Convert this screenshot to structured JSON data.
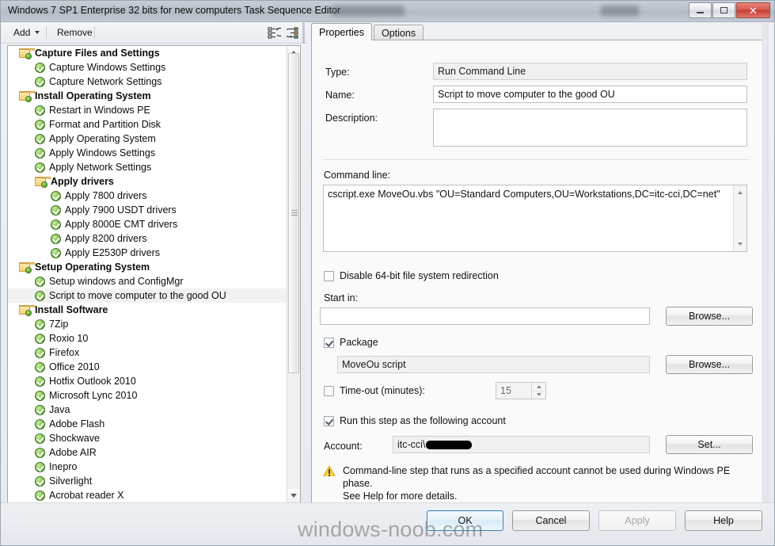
{
  "window": {
    "title": "Windows 7 SP1 Enterprise 32 bits for new computers Task Sequence Editor",
    "minimize_label": "Minimize",
    "maximize_label": "Maximize",
    "close_label": "Close"
  },
  "toolbar": {
    "add_label": "Add",
    "remove_label": "Remove",
    "icon_collapse": "collapse-all-icon",
    "icon_expand": "expand-all-icon"
  },
  "tree": {
    "items": [
      {
        "label": "Capture Files and Settings",
        "level": 1,
        "icon": "folder",
        "group": true,
        "selected": false
      },
      {
        "label": "Capture Windows Settings",
        "level": 2,
        "icon": "check",
        "group": false,
        "selected": false
      },
      {
        "label": "Capture Network Settings",
        "level": 2,
        "icon": "check",
        "group": false,
        "selected": false
      },
      {
        "label": "Install Operating System",
        "level": 1,
        "icon": "folder",
        "group": true,
        "selected": false
      },
      {
        "label": "Restart in Windows PE",
        "level": 2,
        "icon": "check",
        "group": false,
        "selected": false
      },
      {
        "label": "Format and Partition Disk",
        "level": 2,
        "icon": "check",
        "group": false,
        "selected": false
      },
      {
        "label": "Apply Operating System",
        "level": 2,
        "icon": "check",
        "group": false,
        "selected": false
      },
      {
        "label": "Apply Windows Settings",
        "level": 2,
        "icon": "check",
        "group": false,
        "selected": false
      },
      {
        "label": "Apply Network Settings",
        "level": 2,
        "icon": "check",
        "group": false,
        "selected": false
      },
      {
        "label": "Apply drivers",
        "level": 2,
        "icon": "folder",
        "group": true,
        "selected": false
      },
      {
        "label": "Apply 7800 drivers",
        "level": 3,
        "icon": "check",
        "group": false,
        "selected": false
      },
      {
        "label": "Apply 7900 USDT drivers",
        "level": 3,
        "icon": "check",
        "group": false,
        "selected": false
      },
      {
        "label": "Apply 8000E CMT drivers",
        "level": 3,
        "icon": "check",
        "group": false,
        "selected": false
      },
      {
        "label": "Apply 8200 drivers",
        "level": 3,
        "icon": "check",
        "group": false,
        "selected": false
      },
      {
        "label": "Apply E2530P drivers",
        "level": 3,
        "icon": "check",
        "group": false,
        "selected": false
      },
      {
        "label": "Setup Operating System",
        "level": 1,
        "icon": "folder",
        "group": true,
        "selected": false
      },
      {
        "label": "Setup windows and ConfigMgr",
        "level": 2,
        "icon": "check",
        "group": false,
        "selected": false
      },
      {
        "label": "Script to move computer to the good OU",
        "level": 2,
        "icon": "check",
        "group": false,
        "selected": true
      },
      {
        "label": "Install Software",
        "level": 1,
        "icon": "folder",
        "group": true,
        "selected": false
      },
      {
        "label": "7Zip",
        "level": 2,
        "icon": "check",
        "group": false,
        "selected": false
      },
      {
        "label": "Roxio 10",
        "level": 2,
        "icon": "check",
        "group": false,
        "selected": false
      },
      {
        "label": "Firefox",
        "level": 2,
        "icon": "check",
        "group": false,
        "selected": false
      },
      {
        "label": "Office 2010",
        "level": 2,
        "icon": "check",
        "group": false,
        "selected": false
      },
      {
        "label": "Hotfix Outlook 2010",
        "level": 2,
        "icon": "check",
        "group": false,
        "selected": false
      },
      {
        "label": "Microsoft Lync 2010",
        "level": 2,
        "icon": "check",
        "group": false,
        "selected": false
      },
      {
        "label": "Java",
        "level": 2,
        "icon": "check",
        "group": false,
        "selected": false
      },
      {
        "label": "Adobe Flash",
        "level": 2,
        "icon": "check",
        "group": false,
        "selected": false
      },
      {
        "label": "Shockwave",
        "level": 2,
        "icon": "check",
        "group": false,
        "selected": false
      },
      {
        "label": "Adobe AIR",
        "level": 2,
        "icon": "check",
        "group": false,
        "selected": false
      },
      {
        "label": "Inepro",
        "level": 2,
        "icon": "check",
        "group": false,
        "selected": false
      },
      {
        "label": "Silverlight",
        "level": 2,
        "icon": "check",
        "group": false,
        "selected": false
      },
      {
        "label": "Acrobat reader X",
        "level": 2,
        "icon": "check",
        "group": false,
        "selected": false
      }
    ]
  },
  "tabs": [
    {
      "label": "Properties",
      "active": true
    },
    {
      "label": "Options",
      "active": false
    }
  ],
  "properties": {
    "type_label": "Type:",
    "type_value": "Run Command Line",
    "name_label": "Name:",
    "name_value": "Script to move computer to the good OU",
    "description_label": "Description:",
    "description_value": "",
    "command_line_label": "Command line:",
    "command_line_value": "cscript.exe MoveOu.vbs \"OU=Standard Computers,OU=Workstations,DC=itc-cci,DC=net\"",
    "disable_redirection_label": "Disable 64-bit file system redirection",
    "disable_redirection_checked": false,
    "start_in_label": "Start in:",
    "start_in_value": "",
    "start_in_browse_label": "Browse...",
    "package_label": "Package",
    "package_checked": true,
    "package_value": "MoveOu script",
    "package_browse_label": "Browse...",
    "timeout_label": "Time-out (minutes):",
    "timeout_checked": false,
    "timeout_value": "15",
    "run_as_label": "Run this step as the following account",
    "run_as_checked": true,
    "account_label": "Account:",
    "account_value": "itc-cci\\",
    "account_set_label": "Set...",
    "warning_line1": "Command-line step that runs as a specified account cannot be used during Windows PE phase.",
    "warning_line2": "See Help for more details."
  },
  "footer": {
    "ok_label": "OK",
    "cancel_label": "Cancel",
    "apply_label": "Apply",
    "apply_enabled": false,
    "help_label": "Help"
  },
  "watermark": {
    "text": "windows-noob.com"
  },
  "colors": {
    "accent_blue": "#3c7fb1",
    "close_red": "#c63f32",
    "status_green": "#5da134",
    "folder_yellow": "#f3cf72",
    "warning_yellow": "#e8b317"
  }
}
